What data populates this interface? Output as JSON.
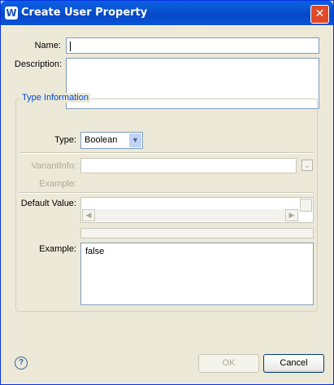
{
  "window": {
    "title": "Create User Property",
    "app_icon_glyph": "W",
    "close_glyph": "✕"
  },
  "form": {
    "name_label": "Name:",
    "name_value": "",
    "description_label": "Description:",
    "description_value": ""
  },
  "type_info": {
    "group_title": "Type Information",
    "type_label": "Type:",
    "type_value": "Boolean",
    "variant_label": "VariantInfo:",
    "variant_value": "",
    "variant_example_label": "Example:",
    "default_label": "Default Value:",
    "example_label": "Example:",
    "example_value": "false"
  },
  "buttons": {
    "ok": "OK",
    "cancel": "Cancel",
    "help_glyph": "?"
  },
  "colors": {
    "title_bar": "#0a5ad8",
    "group_title": "#0046d5",
    "close_button": "#e04a2a"
  }
}
